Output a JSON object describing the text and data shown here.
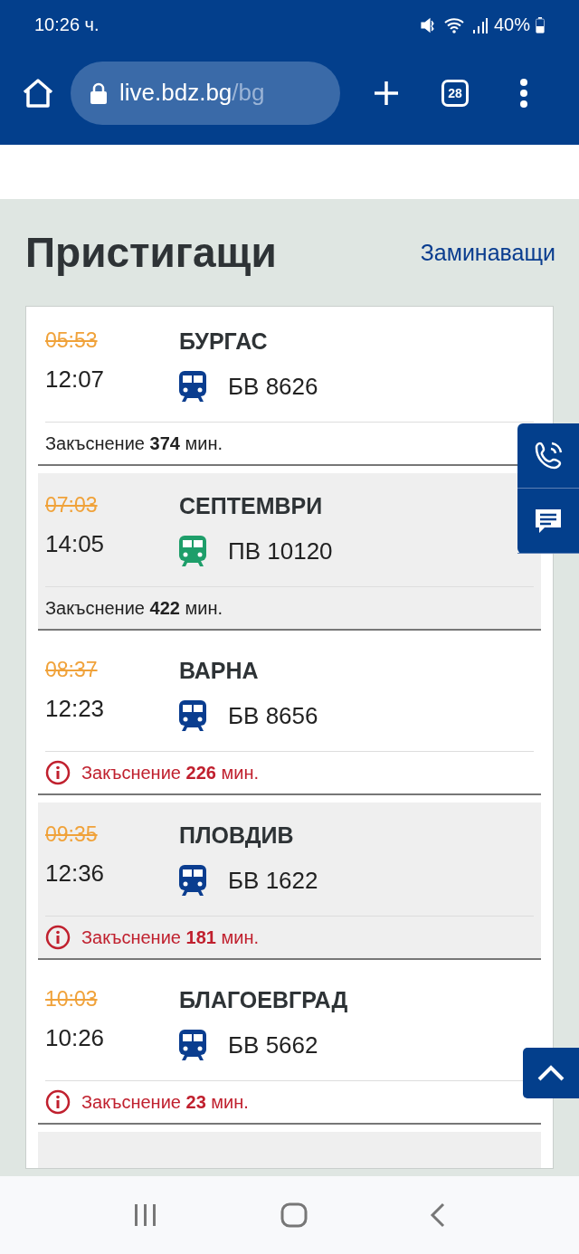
{
  "status_bar": {
    "time": "10:26 ч.",
    "battery": "40%"
  },
  "browser": {
    "url_host": "live.bdz.bg",
    "url_path": "/bg",
    "tab_count": "28"
  },
  "page": {
    "title": "Пристигащи",
    "other_link": "Заминаващи"
  },
  "arrivals": [
    {
      "scheduled": "05:53",
      "expected": "12:07",
      "destination": "БУРГАС",
      "train": "БВ 8626",
      "color": "#0a3d8f",
      "kind": "normal",
      "delay": "Закъснение **374** мин."
    },
    {
      "scheduled": "07:03",
      "expected": "14:05",
      "destination": "СЕПТЕМВРИ",
      "train": "ПВ 10120",
      "color": "#1e9e6a",
      "kind": "normal",
      "delay": "Закъснение **422** мин."
    },
    {
      "scheduled": "08:37",
      "expected": "12:23",
      "destination": "ВАРНА",
      "train": "БВ 8656",
      "color": "#0a3d8f",
      "kind": "alert",
      "delay": "Закъснение **226** мин."
    },
    {
      "scheduled": "09:35",
      "expected": "12:36",
      "destination": "ПЛОВДИВ",
      "train": "БВ 1622",
      "color": "#0a3d8f",
      "kind": "alert",
      "delay": "Закъснение **181** мин."
    },
    {
      "scheduled": "10:03",
      "expected": "10:26",
      "destination": "БЛАГОЕВГРАД",
      "train": "БВ 5662",
      "color": "#0a3d8f",
      "kind": "alert",
      "delay": "Закъснение **23** мин."
    }
  ]
}
